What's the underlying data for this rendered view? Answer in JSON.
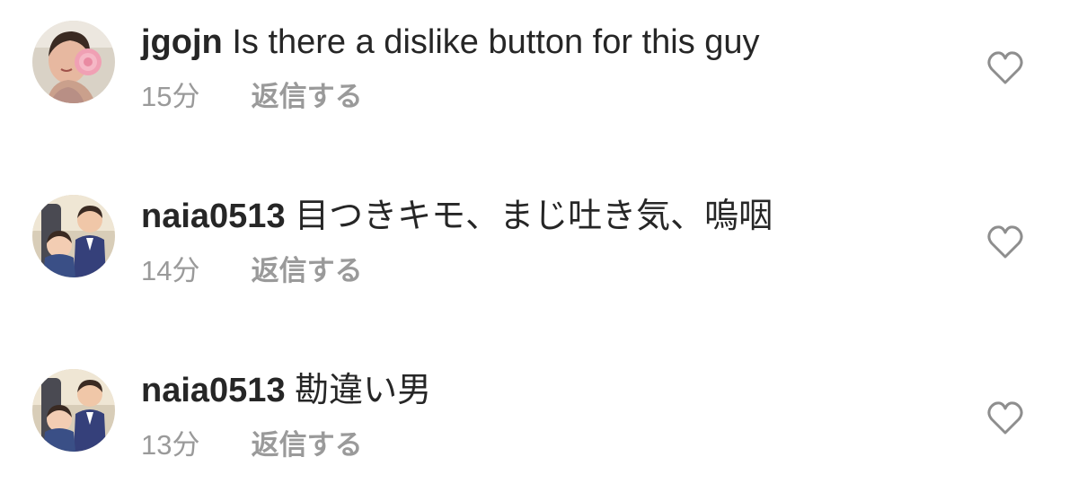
{
  "comments": [
    {
      "username": "jgojn",
      "text": "Is there a dislike button for this guy",
      "time": "15分",
      "reply_label": "返信する",
      "avatar_icon": "user-avatar-woman-with-rose"
    },
    {
      "username": "naia0513",
      "text": "目つきキモ、まじ吐き気、嗚咽",
      "time": "14分",
      "reply_label": "返信する",
      "avatar_icon": "user-avatar-two-children"
    },
    {
      "username": "naia0513",
      "text": "勘違い男",
      "time": "13分",
      "reply_label": "返信する",
      "avatar_icon": "user-avatar-two-children"
    }
  ],
  "icons": {
    "like": "heart-outline-icon"
  },
  "colors": {
    "text": "#262626",
    "meta": "#9a9a9a",
    "icon_stroke": "#8e8e8e",
    "background": "#ffffff"
  }
}
